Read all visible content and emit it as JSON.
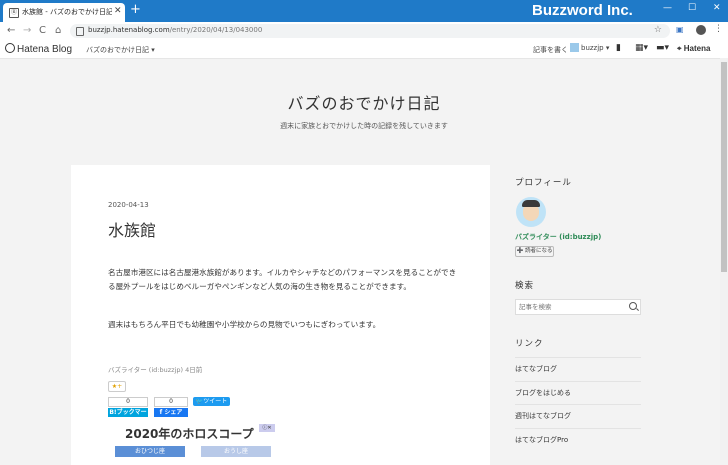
{
  "browser": {
    "tab_title": "水族館 - バズのおでかけ日記",
    "tab_favicon": "Ⓑ",
    "new_tab": "+",
    "brand": "Buzzword Inc.",
    "url_host": "buzzjp.hatenablog.com",
    "url_path": "/entry/2020/04/13/043000",
    "window_min": "—",
    "window_max": "☐",
    "window_close": "✕",
    "nav_back": "←",
    "nav_forward": "→",
    "nav_reload": "C",
    "nav_home": "⌂",
    "star_glyph": "☆",
    "menu_glyph": "⋮"
  },
  "hatena_bar": {
    "logo": "Hatena Blog",
    "blog_menu": "バズのおでかけ日記 ▾",
    "write": "記事を書く",
    "user": "buzzjp ▾",
    "bookmark_glyph": "▮",
    "grid_glyph": "▦▾",
    "chat_glyph": "▬▾",
    "hatena": "Hatena"
  },
  "blog": {
    "title": "バズのおでかけ日記",
    "description": "週末に家族とおでかけした時の記録を残していきます"
  },
  "article": {
    "date": "2020-04-13",
    "title": "水族館",
    "paragraph1": "名古屋市港区には名古屋港水族館があります。イルカやシャチなどのパフォーマンスを見ることができる屋外プールをはじめベルーガやペンギンなど人気の海の生き物を見ることができます。",
    "paragraph2": "週末はもちろん平日でも幼稚園や小学校からの見物でいつもにぎわっています。",
    "footer_meta": "バズライター (id:buzzjp) 4日前",
    "star_button": "★+",
    "bookmark_count": "0",
    "bookmark_label": "B!ブックマーク",
    "share_count": "0",
    "share_label": "f シェア",
    "tweet_label": "ツイート",
    "ad_title": "2020年のホロスコープ",
    "ad_badge": "ⓘ✕",
    "ad_left": "おひつじ座",
    "ad_right": "おうし座",
    "colors": {
      "bookmark": "#00a4de",
      "share": "#1877f2",
      "tweet": "#1d9bf0"
    }
  },
  "sidebar": {
    "profile_heading": "プロフィール",
    "username": "バズライター (id:buzzjp)",
    "reader_button": "➕ 読者になる",
    "search_heading": "検索",
    "search_placeholder": "記事を検索",
    "links_heading": "リンク",
    "links": [
      {
        "label": "はてなブログ"
      },
      {
        "label": "ブログをはじめる"
      },
      {
        "label": "週刊はてなブログ"
      },
      {
        "label": "はてなブログPro"
      }
    ]
  }
}
